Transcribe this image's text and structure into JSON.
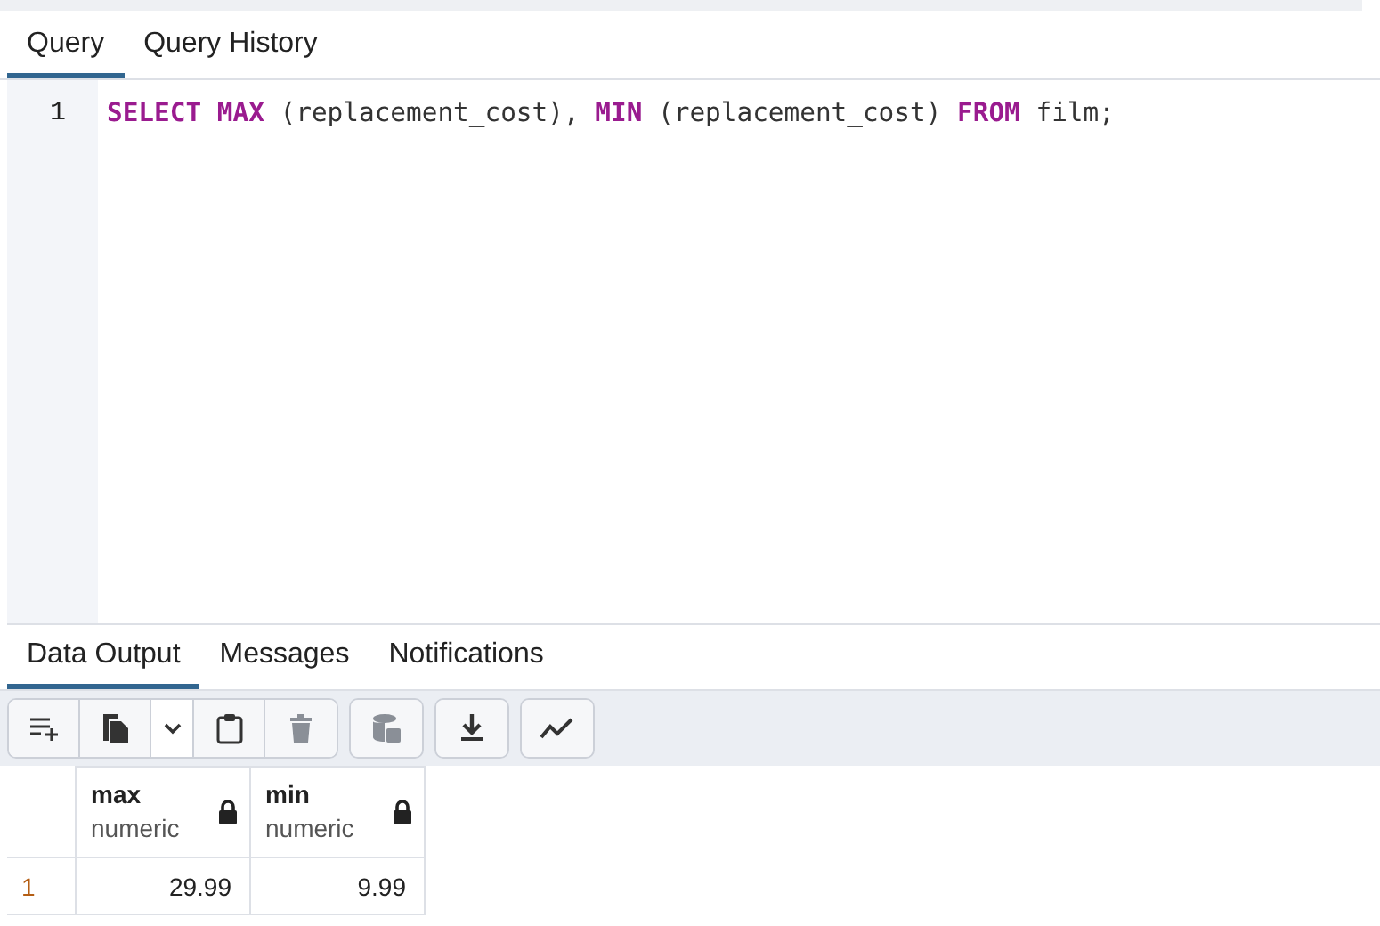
{
  "editor_tabs": [
    {
      "label": "Query",
      "selected": true
    },
    {
      "label": "Query History",
      "selected": false
    }
  ],
  "editor": {
    "lines": [
      {
        "number": "1",
        "tokens": [
          {
            "kind": "keyword",
            "text": "SELECT"
          },
          {
            "kind": "keyword",
            "text": " MAX"
          },
          {
            "kind": "plain",
            "text": " (replacement_cost), "
          },
          {
            "kind": "keyword",
            "text": "MIN"
          },
          {
            "kind": "plain",
            "text": " (replacement_cost) "
          },
          {
            "kind": "keyword",
            "text": "FROM"
          },
          {
            "kind": "plain",
            "text": " film;"
          }
        ]
      }
    ]
  },
  "output_tabs": [
    {
      "label": "Data Output",
      "selected": true
    },
    {
      "label": "Messages",
      "selected": false
    },
    {
      "label": "Notifications",
      "selected": false
    }
  ],
  "toolbar": [
    {
      "buttons": [
        {
          "kind": "add-row",
          "disabled": false
        },
        {
          "kind": "copy",
          "disabled": false
        },
        {
          "kind": "dropdown",
          "disabled": false
        },
        {
          "kind": "paste",
          "disabled": false
        },
        {
          "kind": "delete",
          "disabled": true
        }
      ]
    },
    {
      "buttons": [
        {
          "kind": "save-data",
          "disabled": true
        }
      ]
    },
    {
      "buttons": [
        {
          "kind": "download",
          "disabled": false
        }
      ]
    },
    {
      "buttons": [
        {
          "kind": "graph",
          "disabled": false
        }
      ]
    }
  ],
  "table": {
    "columns": [
      {
        "name": "max",
        "type": "numeric"
      },
      {
        "name": "min",
        "type": "numeric"
      }
    ],
    "rows": [
      {
        "number": "1",
        "cells": [
          "29.99",
          "9.99"
        ]
      }
    ]
  }
}
